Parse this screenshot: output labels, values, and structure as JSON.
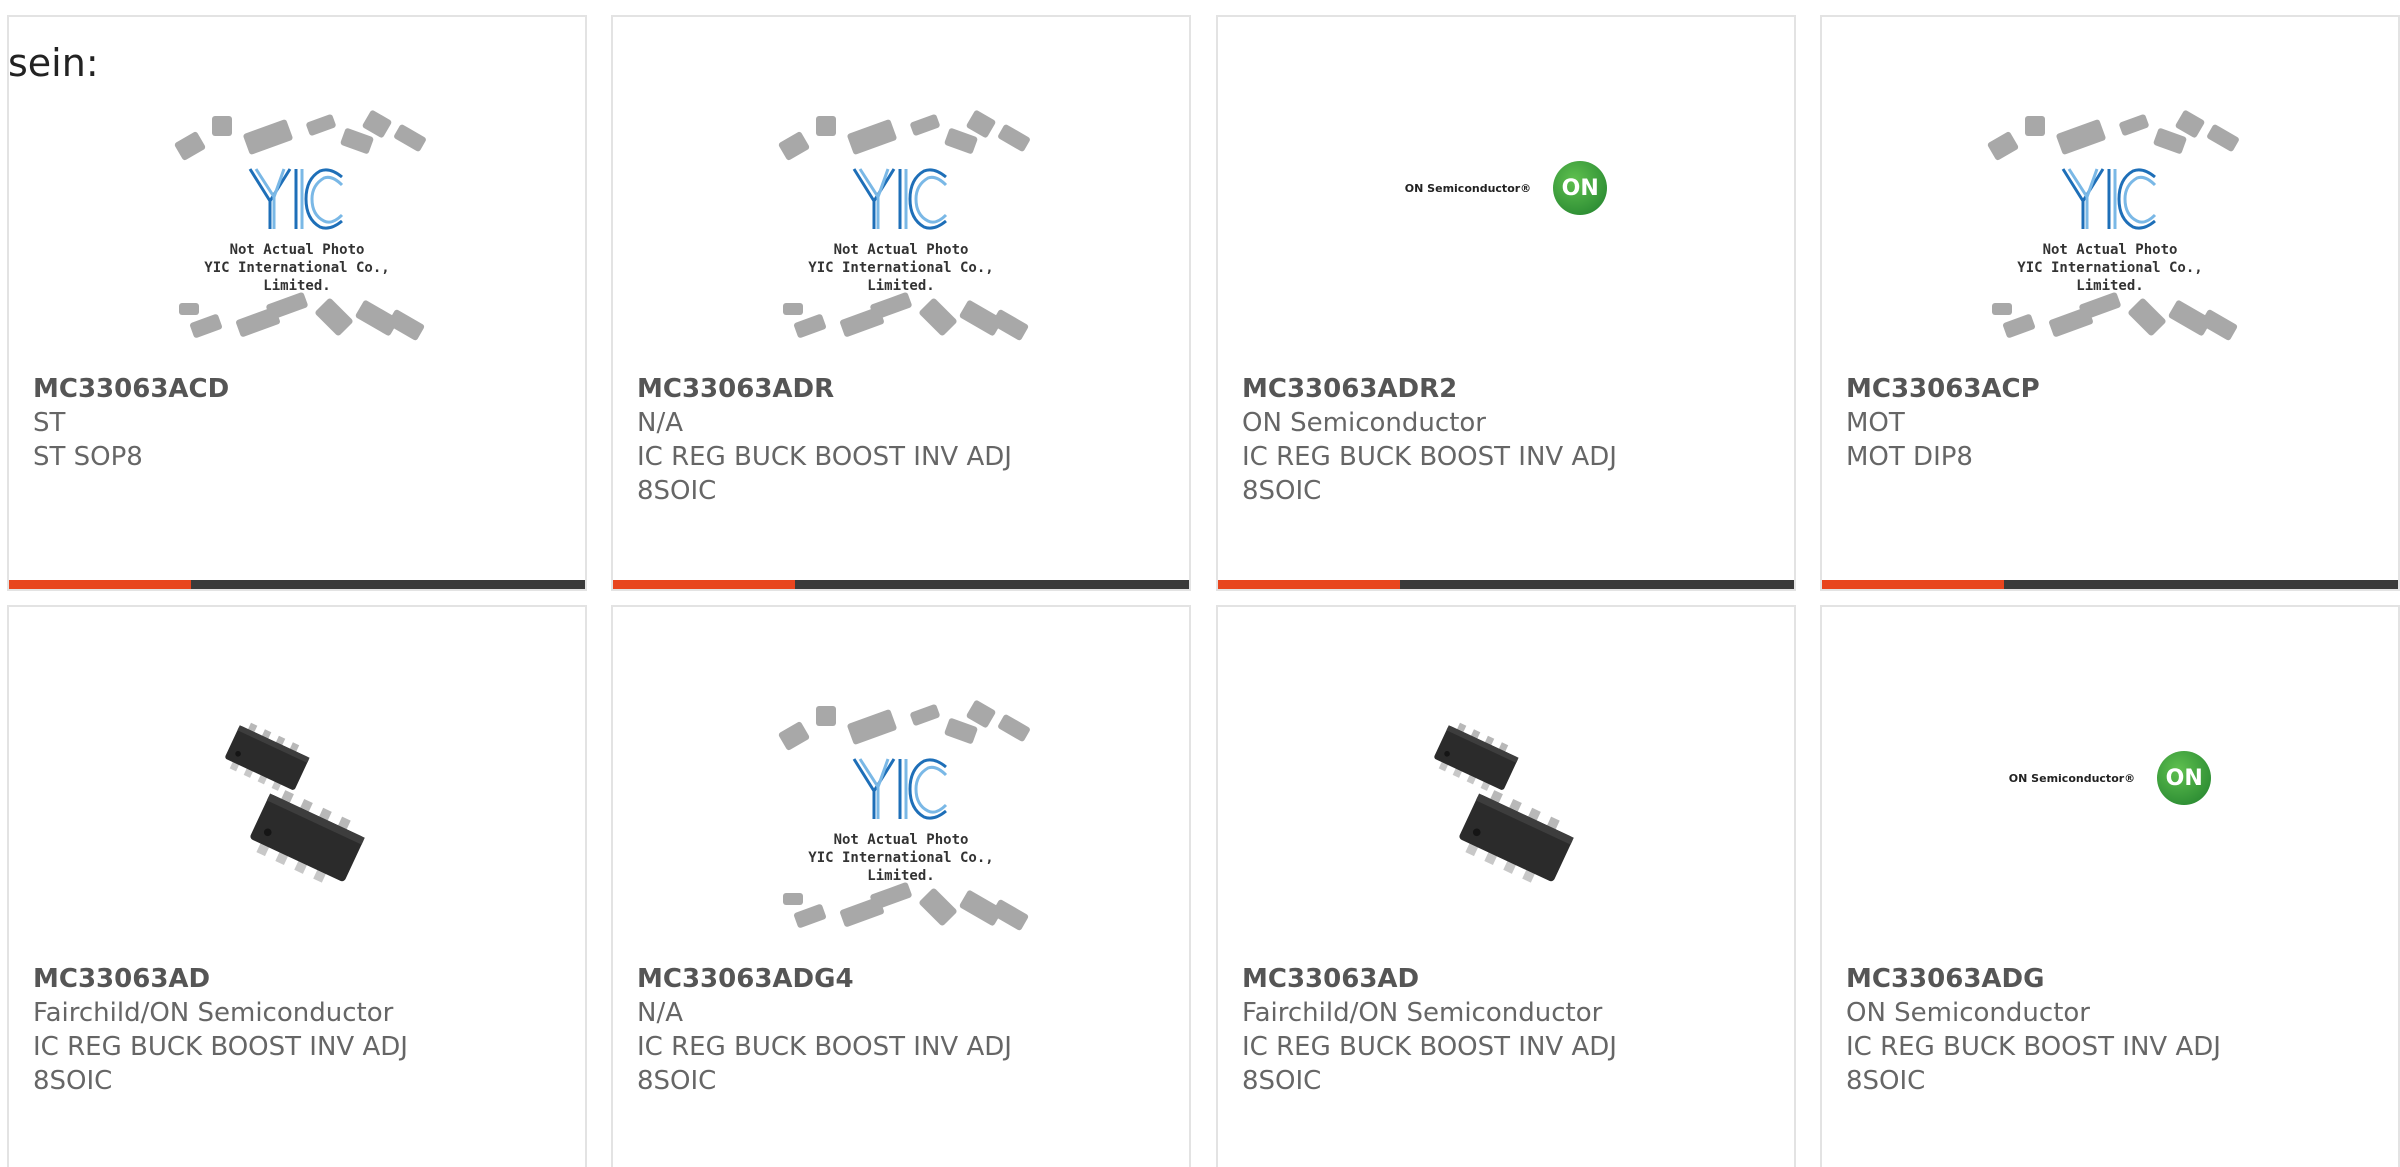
{
  "intro": "sein:",
  "placeholder": {
    "line1": "Not Actual Photo",
    "line2": "YIC International Co., Limited."
  },
  "onsemi_logo_text": "ON Semiconductor®",
  "onsemi_badge": "ON",
  "products": [
    {
      "part": "MC33063ACD",
      "mfr": "ST",
      "desc": "ST SOP8",
      "image": "yic-placeholder"
    },
    {
      "part": "MC33063ADR",
      "mfr": "N/A",
      "desc": "IC REG BUCK BOOST INV ADJ 8SOIC",
      "image": "yic-placeholder"
    },
    {
      "part": "MC33063ADR2",
      "mfr": "ON Semiconductor",
      "desc": "IC REG BUCK BOOST INV ADJ 8SOIC",
      "image": "onsemi-logo"
    },
    {
      "part": "MC33063ACP",
      "mfr": "MOT",
      "desc": "MOT DIP8",
      "image": "yic-placeholder"
    },
    {
      "part": "MC33063AD",
      "mfr": "Fairchild/ON Semiconductor",
      "desc": "IC REG BUCK BOOST INV ADJ 8SOIC",
      "image": "soic-photo"
    },
    {
      "part": "MC33063ADG4",
      "mfr": "N/A",
      "desc": "IC REG BUCK BOOST INV ADJ 8SOIC",
      "image": "yic-placeholder"
    },
    {
      "part": "MC33063AD",
      "mfr": "Fairchild/ON Semiconductor",
      "desc": "IC REG BUCK BOOST INV ADJ 8SOIC",
      "image": "soic-photo"
    },
    {
      "part": "MC33063ADG",
      "mfr": "ON Semiconductor",
      "desc": "IC REG BUCK BOOST INV ADJ 8SOIC",
      "image": "onsemi-logo"
    }
  ],
  "colors": {
    "accent": "#e8451e",
    "bar": "#3a3a3a",
    "onsemi_green": "#2e8b3a"
  }
}
